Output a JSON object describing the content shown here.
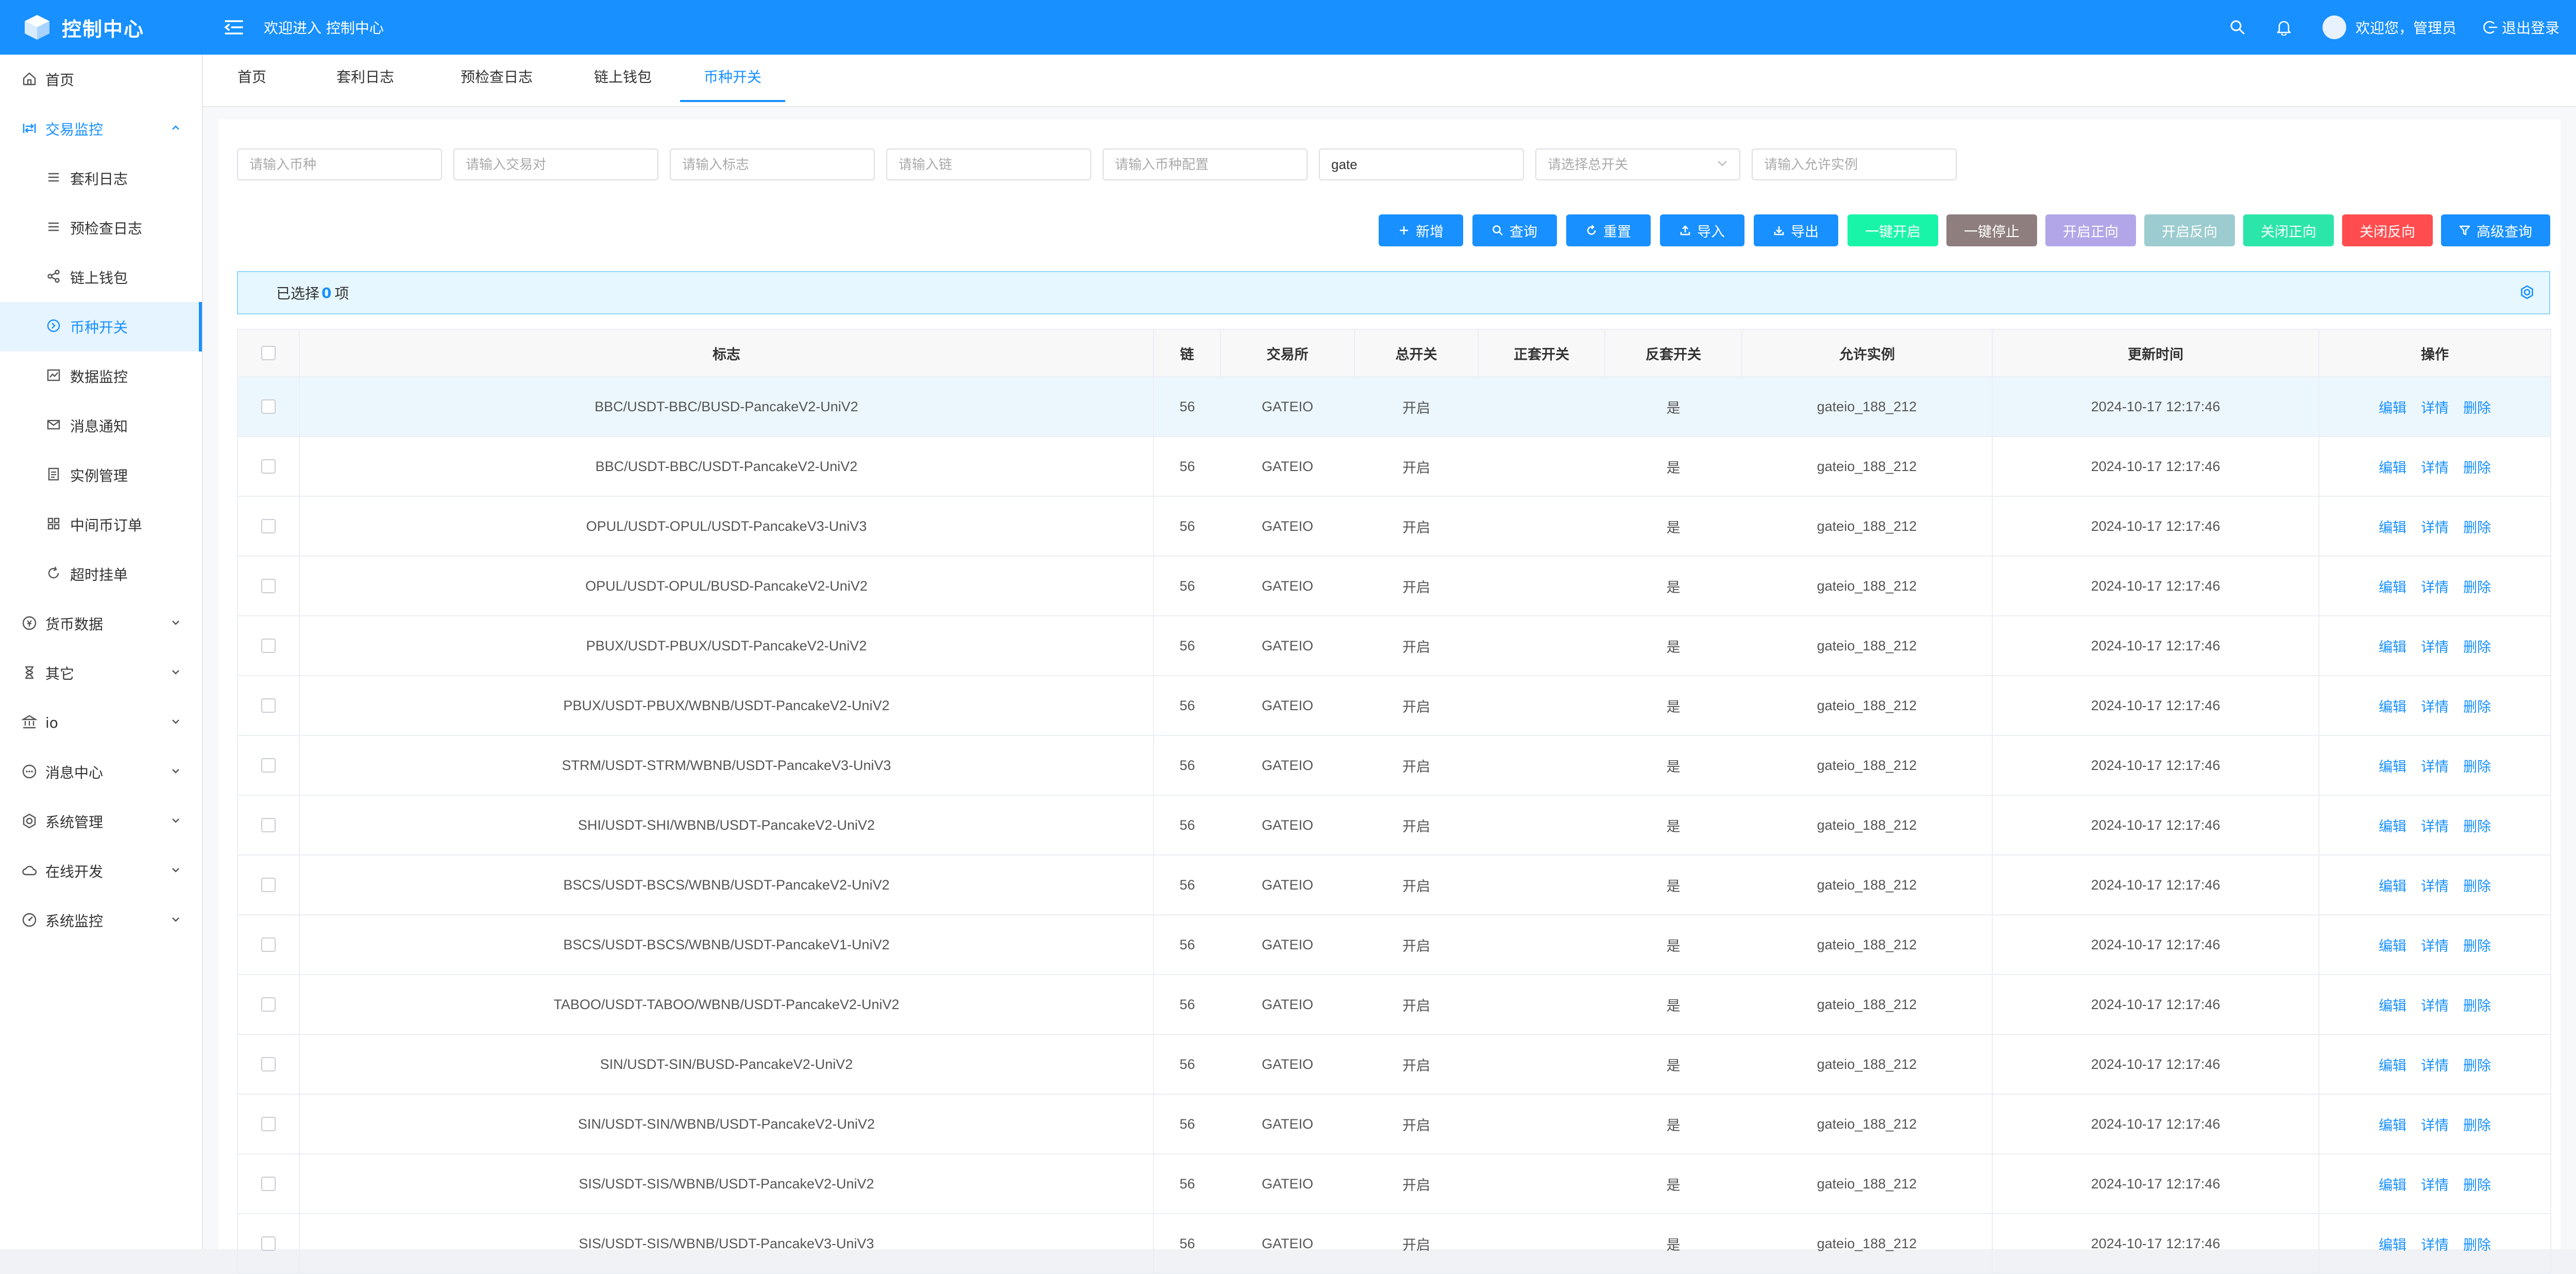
{
  "header": {
    "app_title": "控制中心",
    "welcome_text": "欢迎进入 控制中心",
    "user_text": "欢迎您，管理员",
    "logout_label": "退出登录"
  },
  "sidebar": {
    "items": [
      {
        "label": "首页",
        "icon": "home-icon"
      },
      {
        "label": "交易监控",
        "icon": "exchange-icon"
      },
      {
        "label": "套利日志",
        "icon": "list-icon"
      },
      {
        "label": "预检查日志",
        "icon": "list-icon"
      },
      {
        "label": "链上钱包",
        "icon": "share-icon"
      },
      {
        "label": "币种开关",
        "icon": "coin-icon"
      },
      {
        "label": "数据监控",
        "icon": "chart-icon"
      },
      {
        "label": "消息通知",
        "icon": "mail-icon"
      },
      {
        "label": "实例管理",
        "icon": "document-icon"
      },
      {
        "label": "中间币订单",
        "icon": "grid-icon"
      },
      {
        "label": "超时挂单",
        "icon": "refresh-icon"
      },
      {
        "label": "货币数据",
        "icon": "currency-icon"
      },
      {
        "label": "其它",
        "icon": "hourglass-icon"
      },
      {
        "label": "io",
        "icon": "bank-icon"
      },
      {
        "label": "消息中心",
        "icon": "message-icon"
      },
      {
        "label": "系统管理",
        "icon": "settings-icon"
      },
      {
        "label": "在线开发",
        "icon": "cloud-icon"
      },
      {
        "label": "系统监控",
        "icon": "dashboard-icon"
      }
    ]
  },
  "tabs": [
    "首页",
    "套利日志",
    "预检查日志",
    "链上钱包",
    "币种开关"
  ],
  "filters": {
    "coin_placeholder": "请输入币种",
    "pair_placeholder": "请输入交易对",
    "tag_placeholder": "请输入标志",
    "chain_placeholder": "请输入链",
    "coin_config_placeholder": "请输入币种配置",
    "exchange_value": "gate",
    "main_switch_placeholder": "请选择总开关",
    "instance_placeholder": "请输入允许实例"
  },
  "toolbar": {
    "add": "新增",
    "query": "查询",
    "reset": "重置",
    "import": "导入",
    "export": "导出",
    "start_all": "一键开启",
    "stop_all": "一键停止",
    "open_forward": "开启正向",
    "open_reverse": "开启反向",
    "close_forward": "关闭正向",
    "close_reverse": "关闭反向",
    "advanced_query": "高级查询"
  },
  "selection": {
    "prefix": "已选择",
    "count": "0",
    "suffix": "项"
  },
  "table": {
    "columns": [
      "标志",
      "链",
      "交易所",
      "总开关",
      "正套开关",
      "反套开关",
      "允许实例",
      "更新时间",
      "操作"
    ],
    "actions": [
      "编辑",
      "详情",
      "删除"
    ],
    "rows": [
      {
        "tag": "BBC/USDT-BBC/BUSD-PancakeV2-UniV2",
        "chain": "56",
        "exchange": "GATEIO",
        "main": "开启",
        "forward": "",
        "reverse": "是",
        "instance": "gateio_188_212",
        "updated": "2024-10-17 12:17:46"
      },
      {
        "tag": "BBC/USDT-BBC/USDT-PancakeV2-UniV2",
        "chain": "56",
        "exchange": "GATEIO",
        "main": "开启",
        "forward": "",
        "reverse": "是",
        "instance": "gateio_188_212",
        "updated": "2024-10-17 12:17:46"
      },
      {
        "tag": "OPUL/USDT-OPUL/USDT-PancakeV3-UniV3",
        "chain": "56",
        "exchange": "GATEIO",
        "main": "开启",
        "forward": "",
        "reverse": "是",
        "instance": "gateio_188_212",
        "updated": "2024-10-17 12:17:46"
      },
      {
        "tag": "OPUL/USDT-OPUL/BUSD-PancakeV2-UniV2",
        "chain": "56",
        "exchange": "GATEIO",
        "main": "开启",
        "forward": "",
        "reverse": "是",
        "instance": "gateio_188_212",
        "updated": "2024-10-17 12:17:46"
      },
      {
        "tag": "PBUX/USDT-PBUX/USDT-PancakeV2-UniV2",
        "chain": "56",
        "exchange": "GATEIO",
        "main": "开启",
        "forward": "",
        "reverse": "是",
        "instance": "gateio_188_212",
        "updated": "2024-10-17 12:17:46"
      },
      {
        "tag": "PBUX/USDT-PBUX/WBNB/USDT-PancakeV2-UniV2",
        "chain": "56",
        "exchange": "GATEIO",
        "main": "开启",
        "forward": "",
        "reverse": "是",
        "instance": "gateio_188_212",
        "updated": "2024-10-17 12:17:46"
      },
      {
        "tag": "STRM/USDT-STRM/WBNB/USDT-PancakeV3-UniV3",
        "chain": "56",
        "exchange": "GATEIO",
        "main": "开启",
        "forward": "",
        "reverse": "是",
        "instance": "gateio_188_212",
        "updated": "2024-10-17 12:17:46"
      },
      {
        "tag": "SHI/USDT-SHI/WBNB/USDT-PancakeV2-UniV2",
        "chain": "56",
        "exchange": "GATEIO",
        "main": "开启",
        "forward": "",
        "reverse": "是",
        "instance": "gateio_188_212",
        "updated": "2024-10-17 12:17:46"
      },
      {
        "tag": "BSCS/USDT-BSCS/WBNB/USDT-PancakeV2-UniV2",
        "chain": "56",
        "exchange": "GATEIO",
        "main": "开启",
        "forward": "",
        "reverse": "是",
        "instance": "gateio_188_212",
        "updated": "2024-10-17 12:17:46"
      },
      {
        "tag": "BSCS/USDT-BSCS/WBNB/USDT-PancakeV1-UniV2",
        "chain": "56",
        "exchange": "GATEIO",
        "main": "开启",
        "forward": "",
        "reverse": "是",
        "instance": "gateio_188_212",
        "updated": "2024-10-17 12:17:46"
      },
      {
        "tag": "TABOO/USDT-TABOO/WBNB/USDT-PancakeV2-UniV2",
        "chain": "56",
        "exchange": "GATEIO",
        "main": "开启",
        "forward": "",
        "reverse": "是",
        "instance": "gateio_188_212",
        "updated": "2024-10-17 12:17:46"
      },
      {
        "tag": "SIN/USDT-SIN/BUSD-PancakeV2-UniV2",
        "chain": "56",
        "exchange": "GATEIO",
        "main": "开启",
        "forward": "",
        "reverse": "是",
        "instance": "gateio_188_212",
        "updated": "2024-10-17 12:17:46"
      },
      {
        "tag": "SIN/USDT-SIN/WBNB/USDT-PancakeV2-UniV2",
        "chain": "56",
        "exchange": "GATEIO",
        "main": "开启",
        "forward": "",
        "reverse": "是",
        "instance": "gateio_188_212",
        "updated": "2024-10-17 12:17:46"
      },
      {
        "tag": "SIS/USDT-SIS/WBNB/USDT-PancakeV2-UniV2",
        "chain": "56",
        "exchange": "GATEIO",
        "main": "开启",
        "forward": "",
        "reverse": "是",
        "instance": "gateio_188_212",
        "updated": "2024-10-17 12:17:46"
      },
      {
        "tag": "SIS/USDT-SIS/WBNB/USDT-PancakeV3-UniV3",
        "chain": "56",
        "exchange": "GATEIO",
        "main": "开启",
        "forward": "",
        "reverse": "是",
        "instance": "gateio_188_212",
        "updated": "2024-10-17 12:17:46"
      }
    ]
  },
  "colors": {
    "primary": "#1890ff",
    "start_all": "#19f5a8",
    "stop_all": "#8f7e7e",
    "open_forward": "#b3a6e8",
    "open_reverse": "#9cccd0",
    "close_forward": "#2ce6a9",
    "close_reverse": "#ff4d4f"
  }
}
